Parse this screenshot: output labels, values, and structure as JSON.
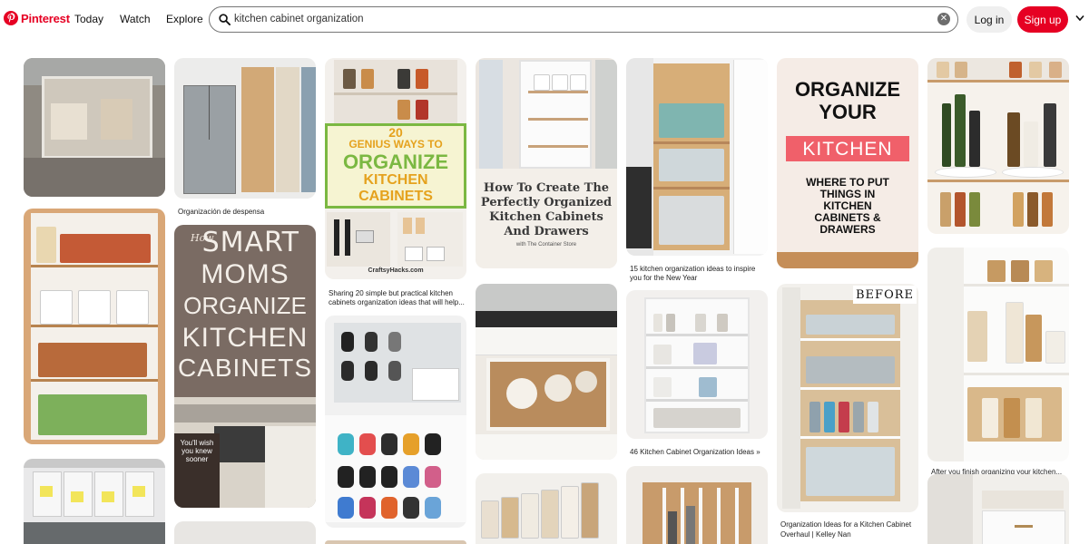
{
  "header": {
    "brand": "Pinterest",
    "nav": [
      "Today",
      "Watch",
      "Explore"
    ],
    "search": {
      "value": "kitchen cabinet organization",
      "placeholder": "Search"
    },
    "login_label": "Log in",
    "signup_label": "Sign up",
    "colors": {
      "brand": "#e60023",
      "login_bg": "#efefef"
    }
  },
  "pins": {
    "c2_1": {
      "caption": "Organización de despensa"
    },
    "c2_2": {
      "title1": "How",
      "title2": "SMART",
      "title3": "MOMS",
      "title4": "ORGANIZE",
      "title5": "KITCHEN",
      "title6": "CABINETS",
      "note": "You'll wish you knew sooner"
    },
    "c3_1": {
      "title1": "20",
      "title2": "GENIUS WAYS TO",
      "title3": "ORGANIZE",
      "title4": "KITCHEN",
      "title5": "CABINETS",
      "brand": "CraftsyHacks.com",
      "caption": "Sharing 20 simple but practical kitchen cabinets organization ideas that will help..."
    },
    "c4_1": {
      "title1": "How To Create The",
      "title2": "Perfectly Organized",
      "title3": "Kitchen Cabinets",
      "title4": "And Drawers",
      "sub": "with The Container Store"
    },
    "c5_1": {
      "caption1": "15 kitchen organization ideas to inspire",
      "caption2": "you for the New Year"
    },
    "c5_2": {
      "caption": "46 Kitchen Cabinet Organization Ideas »"
    },
    "c6_1": {
      "title1": "ORGANIZE",
      "title2": "YOUR",
      "title3": "KITCHEN",
      "sub1": "WHERE TO PUT",
      "sub2": "THINGS IN",
      "sub3": "KITCHEN",
      "sub4": "CABINETS &",
      "sub5": "DRAWERS"
    },
    "c6_2": {
      "badge": "BEFORE",
      "caption1": "Organization Ideas for a Kitchen Cabinet",
      "caption2": "Overhaul | Kelley Nan"
    },
    "c7_2": {
      "caption": "After you finish organizing your kitchen..."
    }
  }
}
